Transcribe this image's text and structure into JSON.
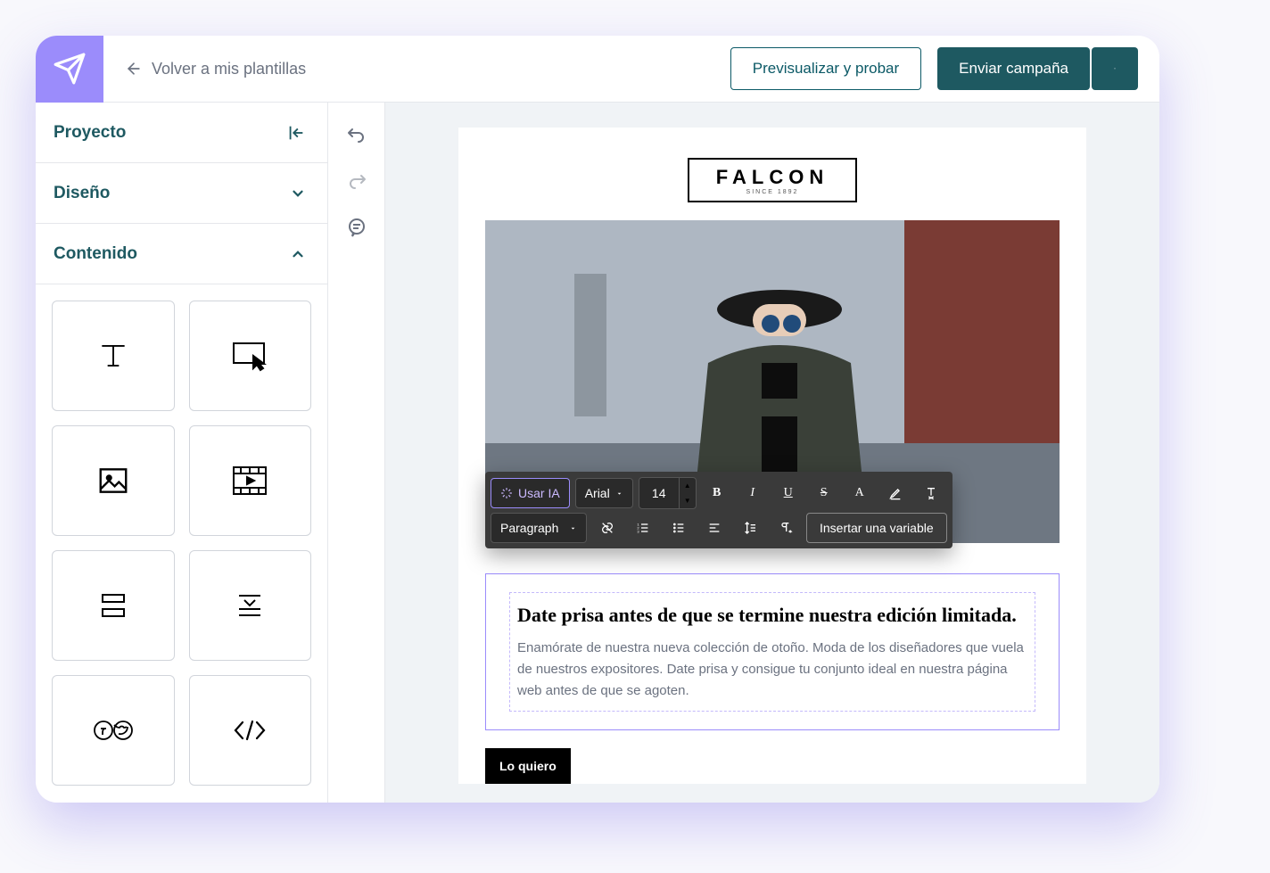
{
  "header": {
    "back_label": "Volver a mis plantillas",
    "preview_label": "Previsualizar y probar",
    "send_label": "Enviar campaña"
  },
  "sidebar": {
    "project_label": "Proyecto",
    "design_label": "Diseño",
    "content_label": "Contenido"
  },
  "toolbar": {
    "ai_label": "Usar IA",
    "font_family": "Arial",
    "font_size": "14",
    "paragraph_label": "Paragraph",
    "insert_variable_label": "Insertar una variable"
  },
  "email": {
    "brand_name": "FALCON",
    "brand_tagline": "SINCE 1892",
    "heading": "Date prisa antes de que se termine nuestra edición limitada.",
    "body": "Enamórate de nuestra nueva colección de otoño. Moda de los diseñadores que vuela de nuestros expositores. Date prisa y consigue tu conjunto ideal en nuestra página web antes de que se agoten.",
    "cta_label": "Lo quiero"
  }
}
